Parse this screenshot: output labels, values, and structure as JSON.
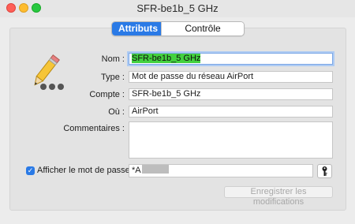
{
  "window": {
    "title": "SFR-be1b_5 GHz"
  },
  "tabs": [
    {
      "label": "Attributs",
      "active": true
    },
    {
      "label": "Contrôle d’accès",
      "active": false
    }
  ],
  "form": {
    "name": {
      "label": "Nom :",
      "value": "SFR-be1b_5 GHz"
    },
    "type": {
      "label": "Type :",
      "value": "Mot de passe du réseau AirPort"
    },
    "account": {
      "label": "Compte :",
      "value": "SFR-be1b_5 GHz"
    },
    "where": {
      "label": "Où :",
      "value": "AirPort"
    },
    "comments": {
      "label": "Commentaires :",
      "value": ""
    },
    "show_password": {
      "label": "Afficher le mot de passe :",
      "checked": true
    },
    "password": {
      "value": "*A"
    }
  },
  "buttons": {
    "save": "Enregistrer les modifications"
  },
  "icons": {
    "app_icon": "pencil-icon",
    "key": "key-icon"
  },
  "colors": {
    "accent": "#2a7ae6",
    "selection_highlight": "#43d13f"
  }
}
